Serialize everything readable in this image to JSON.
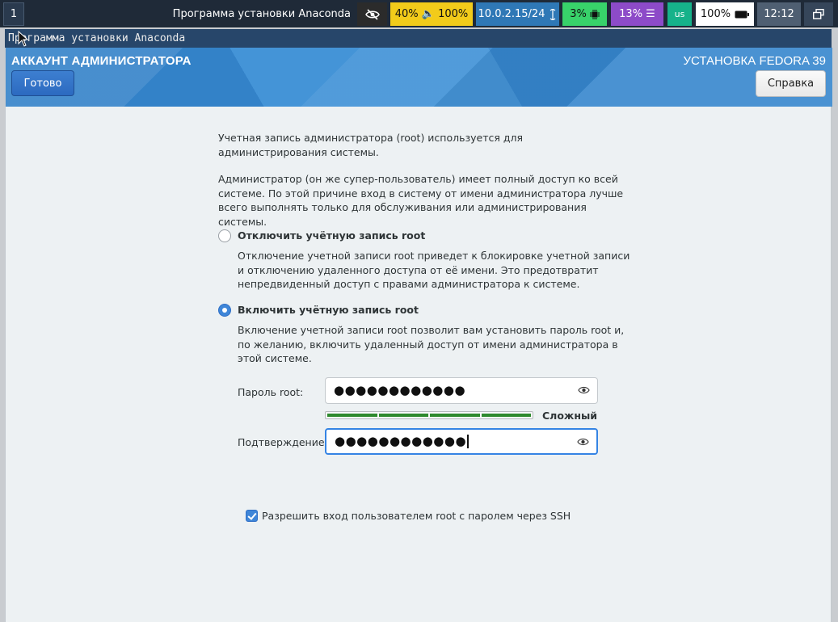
{
  "topbar": {
    "workspace": "1",
    "window_title": "Программа установки Anaconda",
    "audio": "40% 🔈 100%",
    "network": "10.0.2.15/24",
    "cpu": "3%",
    "memory": "13% ☰",
    "keyboard_layout": "us",
    "battery": "100%",
    "clock": "12:12"
  },
  "window": {
    "titlebar": "Программа установки Anaconda"
  },
  "header": {
    "spoke_title": "АККАУНТ АДМИНИСТРАТОРА",
    "product": "УСТАНОВКА FEDORA 39",
    "done_label": "Готово",
    "help_label": "Справка"
  },
  "intro": {
    "p1": "Учетная запись администратора (root) используется для администрирования системы.",
    "p2": "Администратор (он же супер-пользователь) имеет полный доступ ко всей системе. По этой причине вход в систему от имени администратора лучше всего выполнять только для обслуживания или администрирования системы."
  },
  "options": {
    "disable_label": "Отключить учётную запись root",
    "disable_desc": "Отключение учетной записи root приведет к блокировке учетной записи и отключению удаленного доступа от её имени. Это предотвратит непредвиденный доступ с правами администратора к системе.",
    "enable_label": "Включить учётную запись root",
    "enable_desc": "Включение учетной записи root позволит вам установить пароль root и, по желанию, включить удаленный доступ от имени администратора в этой системе.",
    "selected": "enable"
  },
  "password": {
    "root_label": "Пароль root:",
    "root_value": "●●●●●●●●●●●●",
    "confirm_label": "Подтверждение:",
    "confirm_value": "●●●●●●●●●●●●",
    "strength_label": "Сложный",
    "strength_level": 1.0,
    "ssh_label": "Разрешить вход пользователем root с паролем через SSH",
    "ssh_checked": true
  },
  "colors": {
    "header_blue": "#3a8ed5",
    "accent": "#3584e4",
    "strength_green": "#2e8a2e"
  }
}
